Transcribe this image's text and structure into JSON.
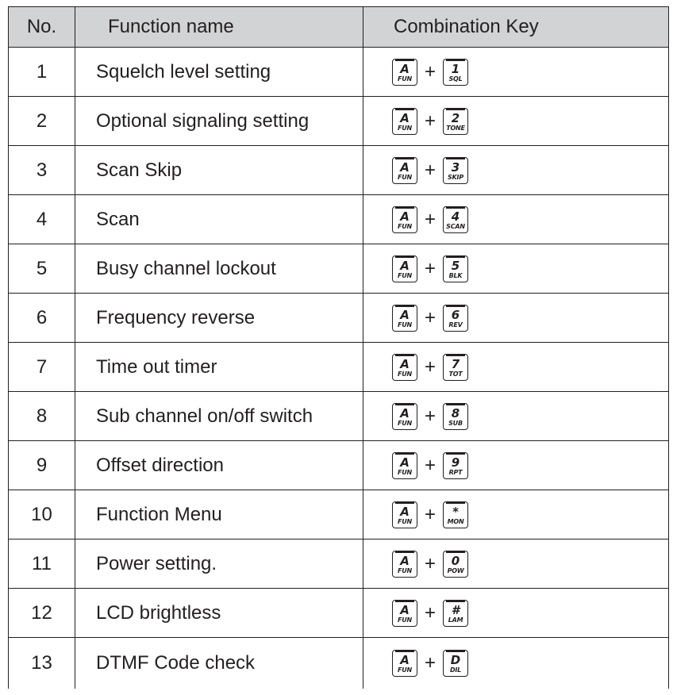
{
  "table": {
    "headers": {
      "no": "No.",
      "function_name": "Function name",
      "combination_key": "Combination Key"
    },
    "plus_sign": "+",
    "fun_key": {
      "main": "A",
      "sub": "FUN"
    },
    "rows": [
      {
        "no": "1",
        "function_name": "Squelch level setting",
        "key_main": "1",
        "key_sub": "SQL"
      },
      {
        "no": "2",
        "function_name": "Optional signaling setting",
        "key_main": "2",
        "key_sub": "TONE"
      },
      {
        "no": "3",
        "function_name": "Scan Skip",
        "key_main": "3",
        "key_sub": "SKIP"
      },
      {
        "no": "4",
        "function_name": "Scan",
        "key_main": "4",
        "key_sub": "SCAN"
      },
      {
        "no": "5",
        "function_name": "Busy channel lockout",
        "key_main": "5",
        "key_sub": "BLK"
      },
      {
        "no": "6",
        "function_name": "Frequency reverse",
        "key_main": "6",
        "key_sub": "REV"
      },
      {
        "no": "7",
        "function_name": "Time out timer",
        "key_main": "7",
        "key_sub": "TOT"
      },
      {
        "no": "8",
        "function_name": "Sub channel on/off switch",
        "key_main": "8",
        "key_sub": "SUB"
      },
      {
        "no": "9",
        "function_name": "Offset direction",
        "key_main": "9",
        "key_sub": "RPT"
      },
      {
        "no": "10",
        "function_name": "Function Menu",
        "key_main": "*",
        "key_sub": "MON"
      },
      {
        "no": "11",
        "function_name": "Power setting.",
        "key_main": "0",
        "key_sub": "POW"
      },
      {
        "no": "12",
        "function_name": "LCD brightless",
        "key_main": "#",
        "key_sub": "LAM"
      },
      {
        "no": "13",
        "function_name": "DTMF Code check",
        "key_main": "D",
        "key_sub": "DIL"
      }
    ]
  },
  "colors": {
    "header_bg": "#d1d3d4",
    "text": "#231f20",
    "border": "#231f20"
  }
}
